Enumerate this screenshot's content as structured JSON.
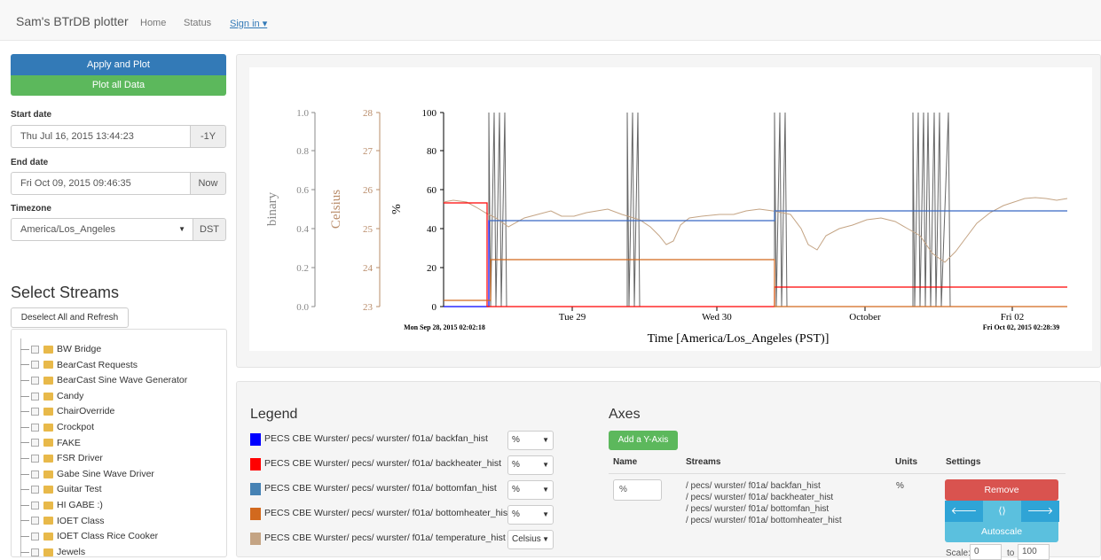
{
  "nav": {
    "brand": "Sam's BTrDB plotter",
    "home": "Home",
    "status": "Status",
    "signin": "Sign in ▾"
  },
  "controls": {
    "apply_label": "Apply and Plot",
    "plot_all_label": "Plot all Data",
    "start_label": "Start date",
    "start_value": "Thu Jul 16, 2015 13:44:23",
    "start_addon": "-1Y",
    "end_label": "End date",
    "end_value": "Fri Oct 09, 2015 09:46:35",
    "end_addon": "Now",
    "tz_label": "Timezone",
    "tz_value": "America/Los_Angeles",
    "tz_addon": "DST"
  },
  "streams": {
    "title": "Select Streams",
    "deselect_label": "Deselect All and Refresh",
    "items": [
      "BW Bridge",
      "BearCast Requests",
      "BearCast Sine Wave Generator",
      "Candy",
      "ChairOverride",
      "Crockpot",
      "FAKE",
      "FSR Driver",
      "Gabe Sine Wave Driver",
      "Guitar Test",
      "HI GABE :)",
      "IOET Class",
      "IOET Class Rice Cooker",
      "Jewels"
    ]
  },
  "plot": {
    "binary_label": "binary",
    "celsius_label": "Celsius",
    "pct_label": "%",
    "x_label": "Time [America/Los_Angeles (PST)]",
    "start_ts": "Mon Sep 28, 2015 02:02:18",
    "end_ts": "Fri Oct 02, 2015 02:28:39",
    "binary_ticks": [
      "1.0",
      "0.8",
      "0.6",
      "0.4",
      "0.2",
      "0.0"
    ],
    "celsius_ticks": [
      "28",
      "27",
      "26",
      "25",
      "24",
      "23"
    ],
    "pct_ticks": [
      "100",
      "80",
      "60",
      "40",
      "20",
      "0"
    ],
    "x_ticks": [
      "Tue 29",
      "Wed 30",
      "October",
      "Fri 02"
    ],
    "colors": {
      "blue": "#0000ff",
      "red": "#ff0000",
      "steel": "#4682b4",
      "orange": "#d2691e",
      "tan": "#c4a484",
      "gray": "#555555",
      "axis_celsius": "#b98c6a",
      "axis_binary": "#888888"
    }
  },
  "legend": {
    "title": "Legend",
    "rows": [
      {
        "text": "PECS CBE Wurster/ pecs/ wurster/ f01a/ backfan_hist",
        "unit": "%",
        "color": "#0000ff"
      },
      {
        "text": "PECS CBE Wurster/ pecs/ wurster/ f01a/ backheater_hist",
        "unit": "%",
        "color": "#ff0000"
      },
      {
        "text": "PECS CBE Wurster/ pecs/ wurster/ f01a/ bottomfan_hist",
        "unit": "%",
        "color": "#4682b4"
      },
      {
        "text": "PECS CBE Wurster/ pecs/ wurster/ f01a/ bottomheater_hist",
        "unit": "%",
        "color": "#d2691e"
      },
      {
        "text": "PECS CBE Wurster/ pecs/ wurster/ f01a/ temperature_hist",
        "unit": "Celsius",
        "color": "#c4a484"
      }
    ]
  },
  "axes": {
    "title": "Axes",
    "add_label": "Add a Y-Axis",
    "headers": {
      "name": "Name",
      "streams": "Streams",
      "units": "Units",
      "settings": "Settings"
    },
    "row": {
      "name": "%",
      "streams": [
        "/ pecs/ wurster/ f01a/ backfan_hist",
        "/ pecs/ wurster/ f01a/ backheater_hist",
        "/ pecs/ wurster/ f01a/ bottomfan_hist",
        "/ pecs/ wurster/ f01a/ bottomheater_hist"
      ],
      "units": "%",
      "remove_label": "Remove",
      "autoscale_label": "Autoscale",
      "scale_label": "Scale:",
      "scale_from": "0",
      "scale_to_label": "to",
      "scale_to": "100"
    }
  }
}
